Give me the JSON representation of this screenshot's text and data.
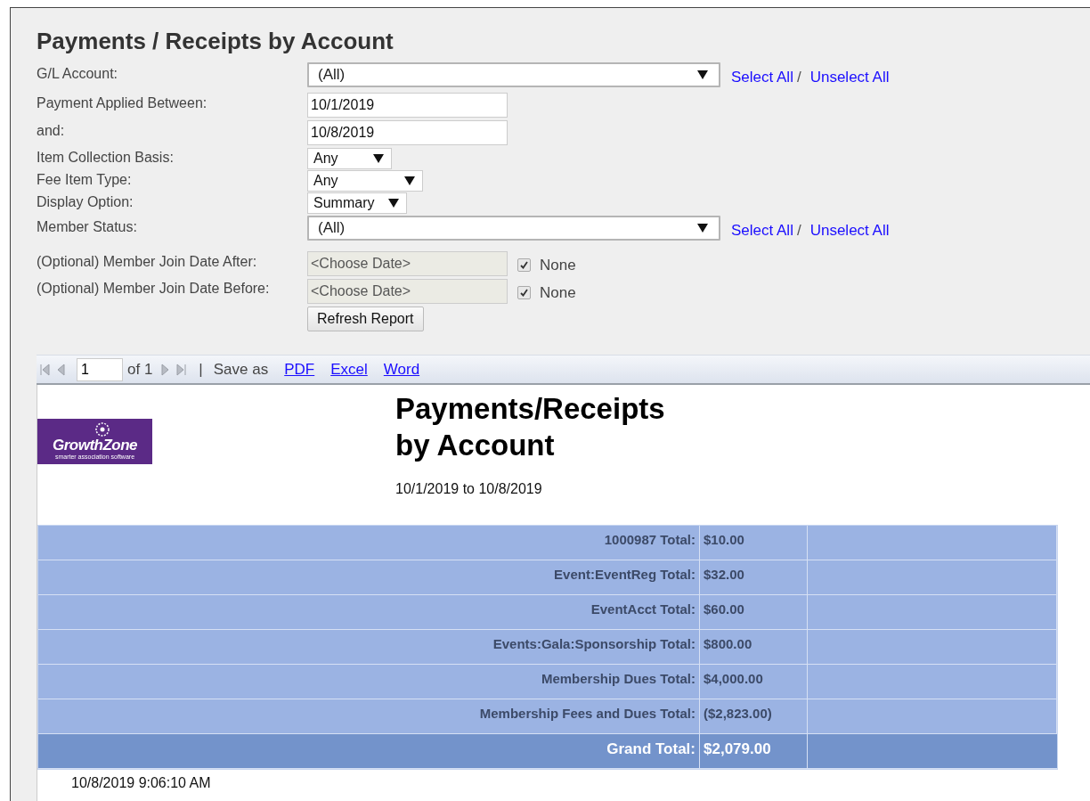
{
  "title": "Payments / Receipts by Account",
  "filters": [
    {
      "kind": "multiselect",
      "label": "G/L Account:",
      "value": "(All)",
      "select_all": "Select All",
      "separator": "/",
      "unselect_all": "Unselect All"
    },
    {
      "kind": "text",
      "label": "Payment Applied Between:",
      "value": "10/1/2019"
    },
    {
      "kind": "text",
      "label": "and:",
      "value": "10/8/2019"
    },
    {
      "kind": "select",
      "label": "Item Collection Basis:",
      "value": "Any"
    },
    {
      "kind": "select",
      "label": "Fee Item Type:",
      "value": "Any"
    },
    {
      "kind": "select",
      "label": "Display Option:",
      "value": "Summary"
    },
    {
      "kind": "multiselect",
      "label": "Member Status:",
      "value": "(All)",
      "select_all": "Select All",
      "separator": "/",
      "unselect_all": "Unselect All"
    },
    {
      "kind": "date",
      "label": "(Optional) Member Join Date After:",
      "placeholder": "<Choose Date>",
      "disabled": true,
      "none_checked": true,
      "none_label": "None"
    },
    {
      "kind": "date",
      "label": "(Optional) Member Join Date Before:",
      "placeholder": "<Choose Date>",
      "disabled": true,
      "none_checked": true,
      "none_label": "None"
    }
  ],
  "refresh_button": "Refresh Report",
  "toolbar": {
    "page": "1",
    "of": "of 1",
    "separator": "|",
    "save_as": "Save as",
    "formats": [
      "PDF",
      "Excel",
      "Word"
    ]
  },
  "report": {
    "logo": {
      "name": "GrowthZone",
      "tagline": "smarter association software"
    },
    "title": "Payments/Receipts by Account",
    "date_range": "10/1/2019 to 10/8/2019",
    "rows": [
      {
        "kind": "account",
        "label": "1000987 Total:",
        "amount": "$10.00"
      },
      {
        "kind": "account",
        "label": "Event:EventReg Total:",
        "amount": "$32.00"
      },
      {
        "kind": "account",
        "label": "EventAcct Total:",
        "amount": "$60.00"
      },
      {
        "kind": "account",
        "label": "Events:Gala:Sponsorship Total:",
        "amount": "$800.00"
      },
      {
        "kind": "account",
        "label": "Membership Dues Total:",
        "amount": "$4,000.00"
      },
      {
        "kind": "account",
        "label": "Membership Fees and Dues Total:",
        "amount": "($2,823.00)"
      },
      {
        "kind": "grand",
        "label": "Grand Total:",
        "amount": "$2,079.00"
      }
    ],
    "timestamp": "10/8/2019 9:06:10 AM"
  }
}
